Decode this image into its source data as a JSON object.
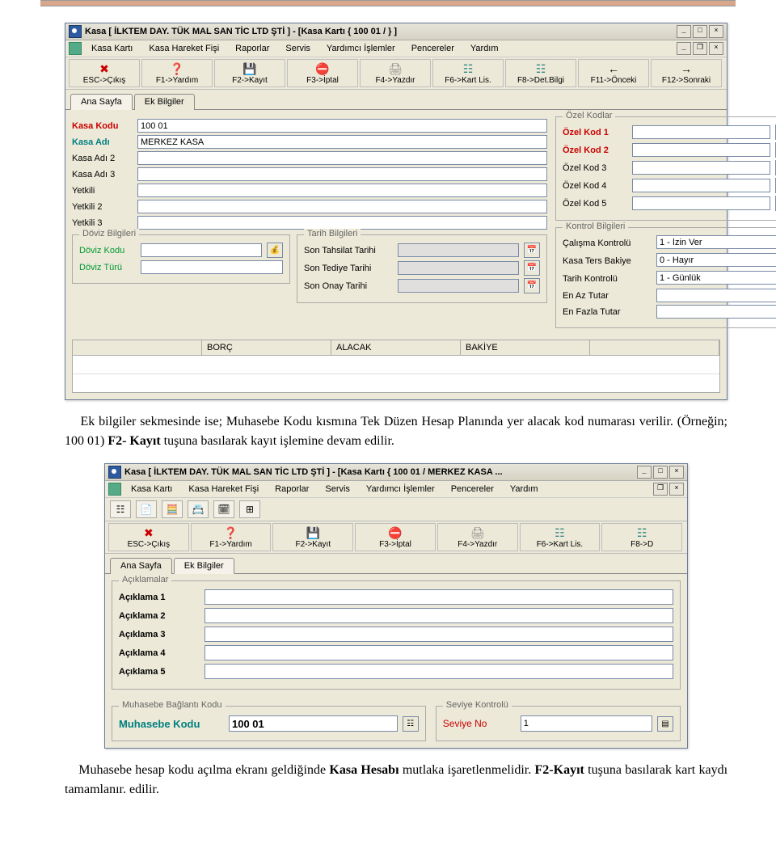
{
  "doc_text1": "Ek bilgiler sekmesinde ise; Muhasebe Kodu kısmına Tek Düzen Hesap Planında yer alacak kod numarası verilir. (Örneğin; 100 01) F2- Kayıt tuşuna basılarak kayıt işlemine devam edilir.",
  "doc_text2": "Muhasebe hesap kodu açılma ekranı geldiğinde Kasa Hesabı mutlaka işaretlenmelidir. F2-Kayıt tuşuna basılarak kart kaydı tamamlanır. edilir.",
  "win1": {
    "title": "Kasa [ İLKTEM DAY. TÜK MAL SAN TİC LTD ŞTİ ]  - [Kasa Kartı { 100 01 /  } ]",
    "menus": [
      "Kasa Kartı",
      "Kasa Hareket Fişi",
      "Raporlar",
      "Servis",
      "Yardımcı İşlemler",
      "Pencereler",
      "Yardım"
    ],
    "fnbtns": [
      {
        "icon": "✖",
        "label": "ESC->Çıkış",
        "color": "#c00"
      },
      {
        "icon": "❓",
        "label": "F1->Yardım",
        "color": "#b89"
      },
      {
        "icon": "💾",
        "label": "F2->Kayıt",
        "color": "#555"
      },
      {
        "icon": "⛔",
        "label": "F3->İptal",
        "color": "#c55"
      },
      {
        "icon": "🖨",
        "label": "F4->Yazdır",
        "color": "#888"
      },
      {
        "icon": "☷",
        "label": "F6->Kart Lis.",
        "color": "#388"
      },
      {
        "icon": "☷",
        "label": "F8->Det.Bilgi",
        "color": "#388"
      },
      {
        "icon": "←",
        "label": "F11->Önceki",
        "color": "#000"
      },
      {
        "icon": "→",
        "label": "F12->Sonraki",
        "color": "#000"
      }
    ],
    "tabs": [
      "Ana Sayfa",
      "Ek Bilgiler"
    ],
    "left_main": [
      {
        "label": "Kasa Kodu",
        "cls": "red",
        "value": "100 01"
      },
      {
        "label": "Kasa Adı",
        "cls": "teal",
        "value": "MERKEZ KASA"
      },
      {
        "label": "Kasa Adı 2",
        "cls": "",
        "value": ""
      },
      {
        "label": "Kasa Adı 3",
        "cls": "",
        "value": ""
      },
      {
        "label": "Yetkili",
        "cls": "",
        "value": ""
      },
      {
        "label": "Yetkili 2",
        "cls": "",
        "value": ""
      },
      {
        "label": "Yetkili 3",
        "cls": "",
        "value": ""
      }
    ],
    "doviz": {
      "title": "Döviz Bilgileri",
      "rows": [
        {
          "label": "Döviz Kodu",
          "cls": "green",
          "btn": "💰"
        },
        {
          "label": "Döviz Türü",
          "cls": "green",
          "btn": ""
        }
      ]
    },
    "tarih": {
      "title": "Tarih Bilgileri",
      "rows": [
        {
          "label": "Son Tahsilat Tarihi",
          "btn": "📅"
        },
        {
          "label": "Son Tediye Tarihi",
          "btn": "📅"
        },
        {
          "label": "Son Onay Tarihi",
          "btn": "📅"
        }
      ]
    },
    "ozel": {
      "title": "Özel Kodlar",
      "rows": [
        {
          "label": "Özel Kod 1",
          "cls": "red"
        },
        {
          "label": "Özel Kod 2",
          "cls": "red"
        },
        {
          "label": "Özel Kod 3",
          "cls": ""
        },
        {
          "label": "Özel Kod 4",
          "cls": ""
        },
        {
          "label": "Özel Kod 5",
          "cls": ""
        }
      ]
    },
    "kontrol": {
      "title": "Kontrol Bilgileri",
      "rows": [
        {
          "label": "Çalışma Kontrolü",
          "value": "1 - İzin Ver",
          "type": "combo"
        },
        {
          "label": "Kasa Ters Bakiye",
          "value": "0 - Hayır",
          "type": "combo"
        },
        {
          "label": "Tarih Kontrolü",
          "value": "1 - Günlük",
          "type": "combo"
        },
        {
          "label": "En Az Tutar",
          "value": "",
          "type": "text"
        },
        {
          "label": "En Fazla Tutar",
          "value": "",
          "type": "text"
        }
      ]
    },
    "grid": [
      "",
      "BORÇ",
      "ALACAK",
      "BAKİYE",
      ""
    ]
  },
  "win2": {
    "title": "Kasa [ İLKTEM DAY. TÜK MAL SAN TİC LTD ŞTİ ]  - [Kasa Kartı { 100 01 / MERKEZ KASA ...",
    "menus": [
      "Kasa Kartı",
      "Kasa Hareket Fişi",
      "Raporlar",
      "Servis",
      "Yardımcı İşlemler",
      "Pencereler",
      "Yardım"
    ],
    "fnbtns": [
      {
        "icon": "✖",
        "label": "ESC->Çıkış",
        "color": "#c00"
      },
      {
        "icon": "❓",
        "label": "F1->Yardım",
        "color": "#b89"
      },
      {
        "icon": "💾",
        "label": "F2->Kayıt",
        "color": "#555"
      },
      {
        "icon": "⛔",
        "label": "F3->İptal",
        "color": "#c55"
      },
      {
        "icon": "🖨",
        "label": "F4->Yazdır",
        "color": "#888"
      },
      {
        "icon": "☷",
        "label": "F6->Kart Lis.",
        "color": "#388"
      },
      {
        "icon": "☷",
        "label": "F8->D",
        "color": "#388"
      }
    ],
    "tabs": [
      "Ana Sayfa",
      "Ek Bilgiler"
    ],
    "aciklamalar": {
      "title": "Açıklamalar",
      "rows": [
        "Açıklama 1",
        "Açıklama 2",
        "Açıklama 3",
        "Açıklama 4",
        "Açıklama 5"
      ]
    },
    "muh": {
      "title": "Muhasebe Bağlantı Kodu",
      "label": "Muhasebe Kodu",
      "value": "100 01"
    },
    "sev": {
      "title": "Seviye Kontrolü",
      "label": "Seviye No",
      "value": "1"
    }
  }
}
